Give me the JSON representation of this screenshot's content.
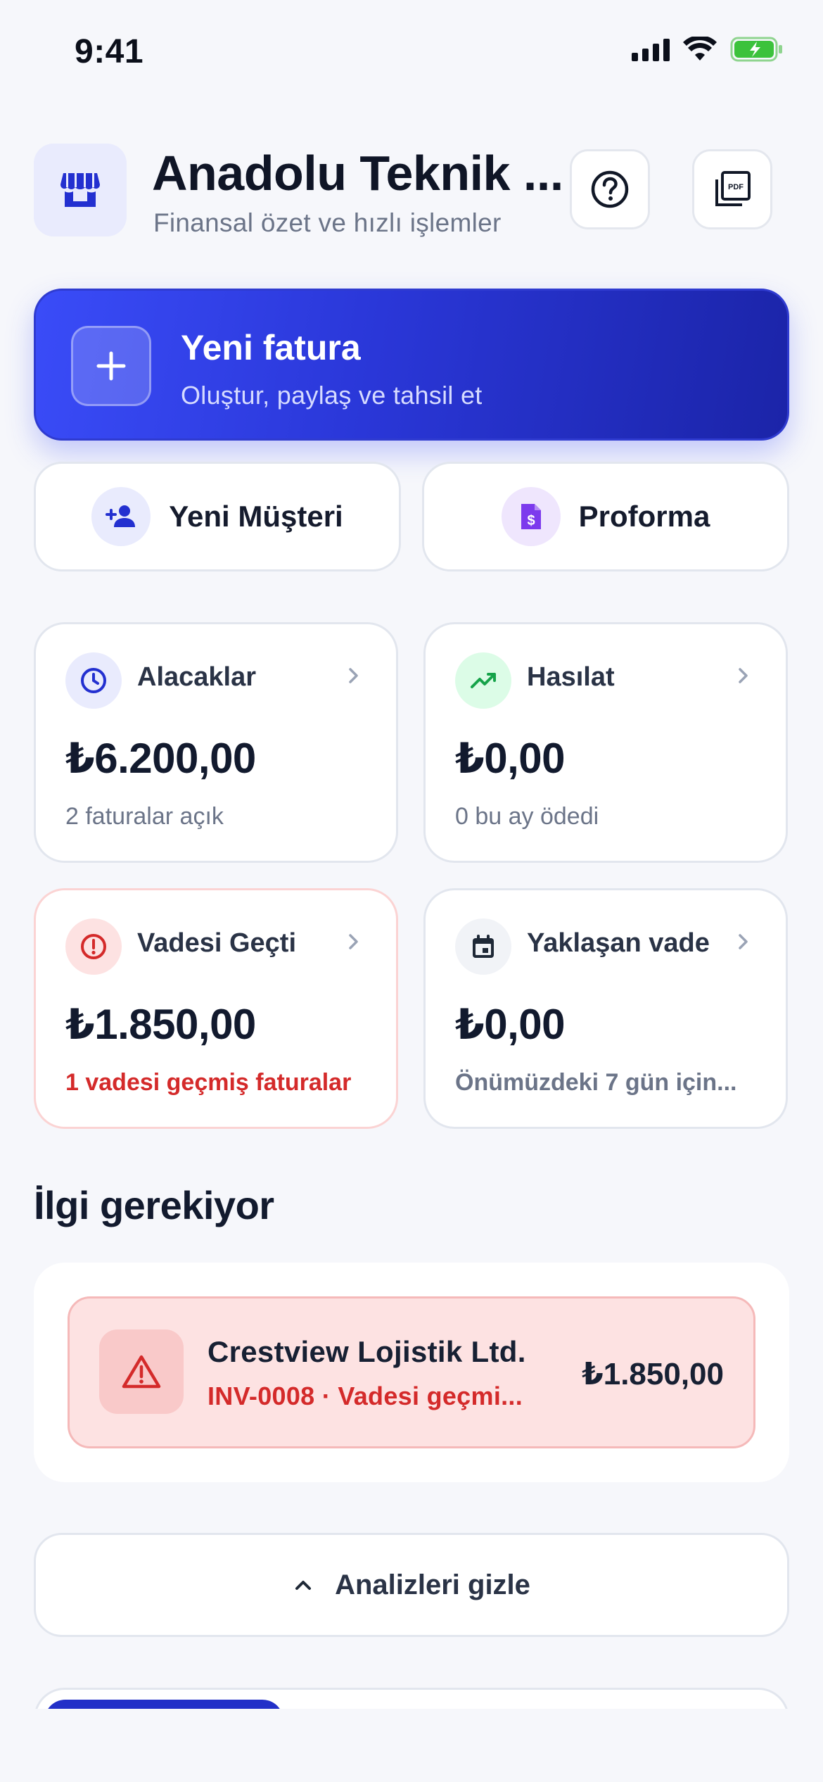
{
  "status_bar": {
    "time": "9:41"
  },
  "header": {
    "title": "Anadolu Teknik ...",
    "subtitle": "Finansal özet ve hızlı işlemler",
    "store_icon": "storefront-icon",
    "help_icon": "help-circle-icon",
    "pdf_icon": "pdf-document-icon"
  },
  "primary_action": {
    "title": "Yeni fatura",
    "subtitle": "Oluştur, paylaş ve tahsil et",
    "icon": "plus-icon"
  },
  "quick_actions": [
    {
      "label": "Yeni Müşteri",
      "icon": "add-person-icon"
    },
    {
      "label": "Proforma",
      "icon": "invoice-document-icon"
    }
  ],
  "stats": {
    "receivables": {
      "label": "Alacaklar",
      "value": "₺6.200,00",
      "note": "2 faturalar açık",
      "icon": "clock-icon"
    },
    "revenue": {
      "label": "Hasılat",
      "value": "₺0,00",
      "note": "0 bu ay ödedi",
      "icon": "trending-up-icon"
    },
    "overdue": {
      "label": "Vadesi Geçti",
      "value": "₺1.850,00",
      "note": "1 vadesi geçmiş faturalar",
      "icon": "alert-circle-icon"
    },
    "upcoming": {
      "label": "Yaklaşan vade",
      "value": "₺0,00",
      "note": "Önümüzdeki 7 gün için...",
      "icon": "calendar-icon"
    }
  },
  "attention": {
    "title": "İlgi gerekiyor",
    "items": [
      {
        "customer": "Crestview Lojistik Ltd.",
        "meta": "INV-0008 · Vadesi geçmi...",
        "amount": "₺1.850,00",
        "icon": "warning-triangle-icon"
      }
    ]
  },
  "analytics_toggle": {
    "label": "Analizleri gizle",
    "icon": "chevron-up-icon"
  },
  "colors": {
    "primary": "#2a37d8",
    "danger": "#d42a2a",
    "success": "#16a34a",
    "background": "#f6f7fb"
  }
}
